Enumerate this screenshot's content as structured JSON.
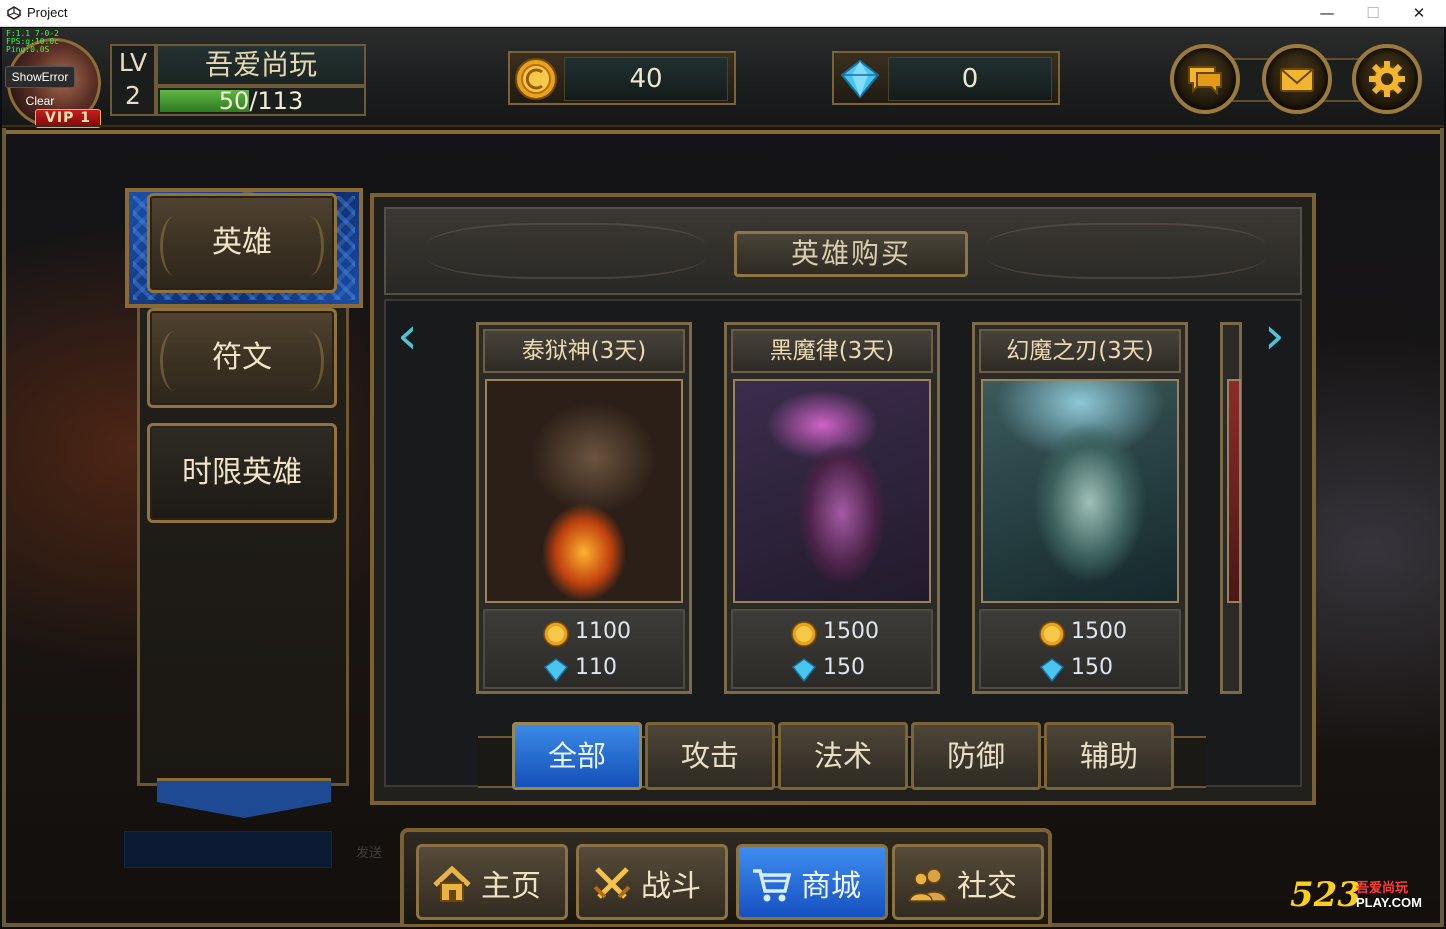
{
  "window": {
    "title": "Project",
    "minimize_glyph": "—",
    "maximize_glyph": "☐",
    "close_glyph": "✕"
  },
  "debug": {
    "lines": [
      "F:1.1 7-0-2",
      "FPS:g:10.0c",
      "Ping:0.0S"
    ],
    "show_error_label": "ShowError",
    "clear_label": "Clear"
  },
  "player": {
    "vip_label": "VIP 1",
    "level_label": "LV",
    "level": "2",
    "name": "吾爱尚玩",
    "xp_current": "50",
    "xp_separator": "/",
    "xp_max": "113",
    "xp_fraction": 0.44
  },
  "currency": {
    "gold": "40",
    "gems": "0"
  },
  "side_menu": {
    "items": [
      {
        "label": "英雄"
      },
      {
        "label": "符文"
      },
      {
        "label": "时限英雄"
      }
    ]
  },
  "chat": {
    "send_label": "发送"
  },
  "shop": {
    "title": "英雄购买",
    "prev_glyph": "‹",
    "next_glyph": "›",
    "heroes": [
      {
        "name": "泰狱神(3天)",
        "gold_price": "1100",
        "gem_price": "110"
      },
      {
        "name": "黑魔律(3天)",
        "gold_price": "1500",
        "gem_price": "150"
      },
      {
        "name": "幻魔之刃(3天)",
        "gold_price": "1500",
        "gem_price": "150"
      }
    ],
    "tabs": [
      {
        "label": "全部",
        "active": true
      },
      {
        "label": "攻击",
        "active": false
      },
      {
        "label": "法术",
        "active": false
      },
      {
        "label": "防御",
        "active": false
      },
      {
        "label": "辅助",
        "active": false
      }
    ]
  },
  "bottom_nav": {
    "items": [
      {
        "label": "主页",
        "icon": "home-icon"
      },
      {
        "label": "战斗",
        "icon": "crossed-swords-icon"
      },
      {
        "label": "商城",
        "icon": "shopping-cart-icon",
        "active": true
      },
      {
        "label": "社交",
        "icon": "users-icon"
      }
    ]
  },
  "watermark": {
    "number": "523",
    "cn": "吾爱尚玩",
    "en": "PLAY.COM"
  },
  "colors": {
    "gold_trim": "#8c6a33",
    "active_blue": "#1f64d0",
    "xp_green": "#4ea336",
    "gem_cyan": "#4cc3d8"
  }
}
